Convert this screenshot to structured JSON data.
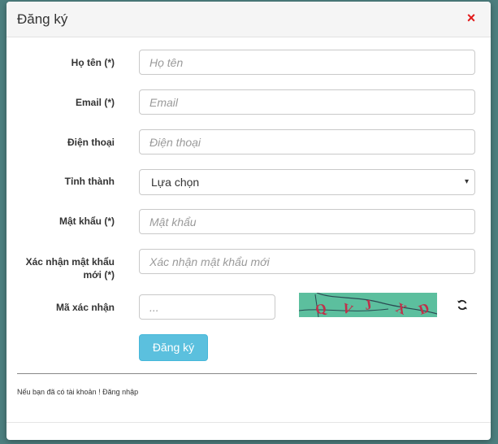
{
  "modal": {
    "title": "Đăng ký",
    "close_symbol": "×"
  },
  "form": {
    "fields": [
      {
        "label": "Họ tên (*)",
        "placeholder": "Họ tên"
      },
      {
        "label": "Email (*)",
        "placeholder": "Email"
      },
      {
        "label": "Điện thoại",
        "placeholder": "Điện thoại"
      },
      {
        "label": "Tỉnh thành",
        "value": "Lựa chọn"
      },
      {
        "label": "Mật khẩu (*)",
        "placeholder": "Mật khẩu"
      },
      {
        "label_line1": "Xác nhận mật khẩu",
        "label_line2": "mới (*)",
        "placeholder": "Xác nhận mật khẩu mới"
      },
      {
        "label": "Mã xác nhận",
        "placeholder": "..."
      }
    ],
    "submit_label": "Đăng ký",
    "caret": "▾"
  },
  "captcha": {
    "letters": [
      "Q",
      "V",
      "J",
      "X",
      "D"
    ],
    "background": "#5cbf9e",
    "letter_color": "#c0304a"
  },
  "footer": {
    "note": "Nếu bạn đã có tài khoản ! Đăng nhập"
  },
  "icons": {
    "close": "close-icon",
    "refresh": "refresh-icon",
    "dropdown": "chevron-down-icon"
  },
  "colors": {
    "accent": "#5bc0de",
    "close": "#e21a1a"
  }
}
